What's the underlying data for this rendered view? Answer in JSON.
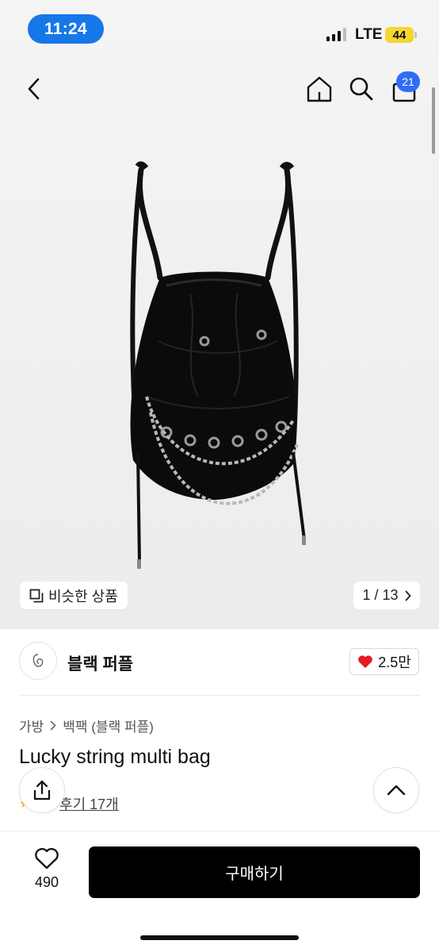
{
  "status_bar": {
    "time": "11:24",
    "network": "LTE",
    "battery": "44"
  },
  "header": {
    "back_icon": "chevron-left-icon",
    "home_icon": "home-icon",
    "search_icon": "search-icon",
    "cart_icon": "shopping-bag-icon",
    "cart_count": "21"
  },
  "gallery": {
    "similar_label": "비슷한 상품",
    "page_indicator": "1 / 13"
  },
  "shop": {
    "name": "블랙 퍼플",
    "likes": "2.5만"
  },
  "product": {
    "breadcrumb": [
      "가방",
      "백팩 (블랙 퍼플)"
    ],
    "title": "Lucky string multi bag",
    "reviews": "후기 17개"
  },
  "bottom_bar": {
    "wish_count": "490",
    "buy_label": "구매하기"
  },
  "colors": {
    "accent_blue": "#1677e8",
    "badge_blue": "#2f6df6",
    "heart_red": "#e31b23",
    "button_black": "#000000"
  }
}
